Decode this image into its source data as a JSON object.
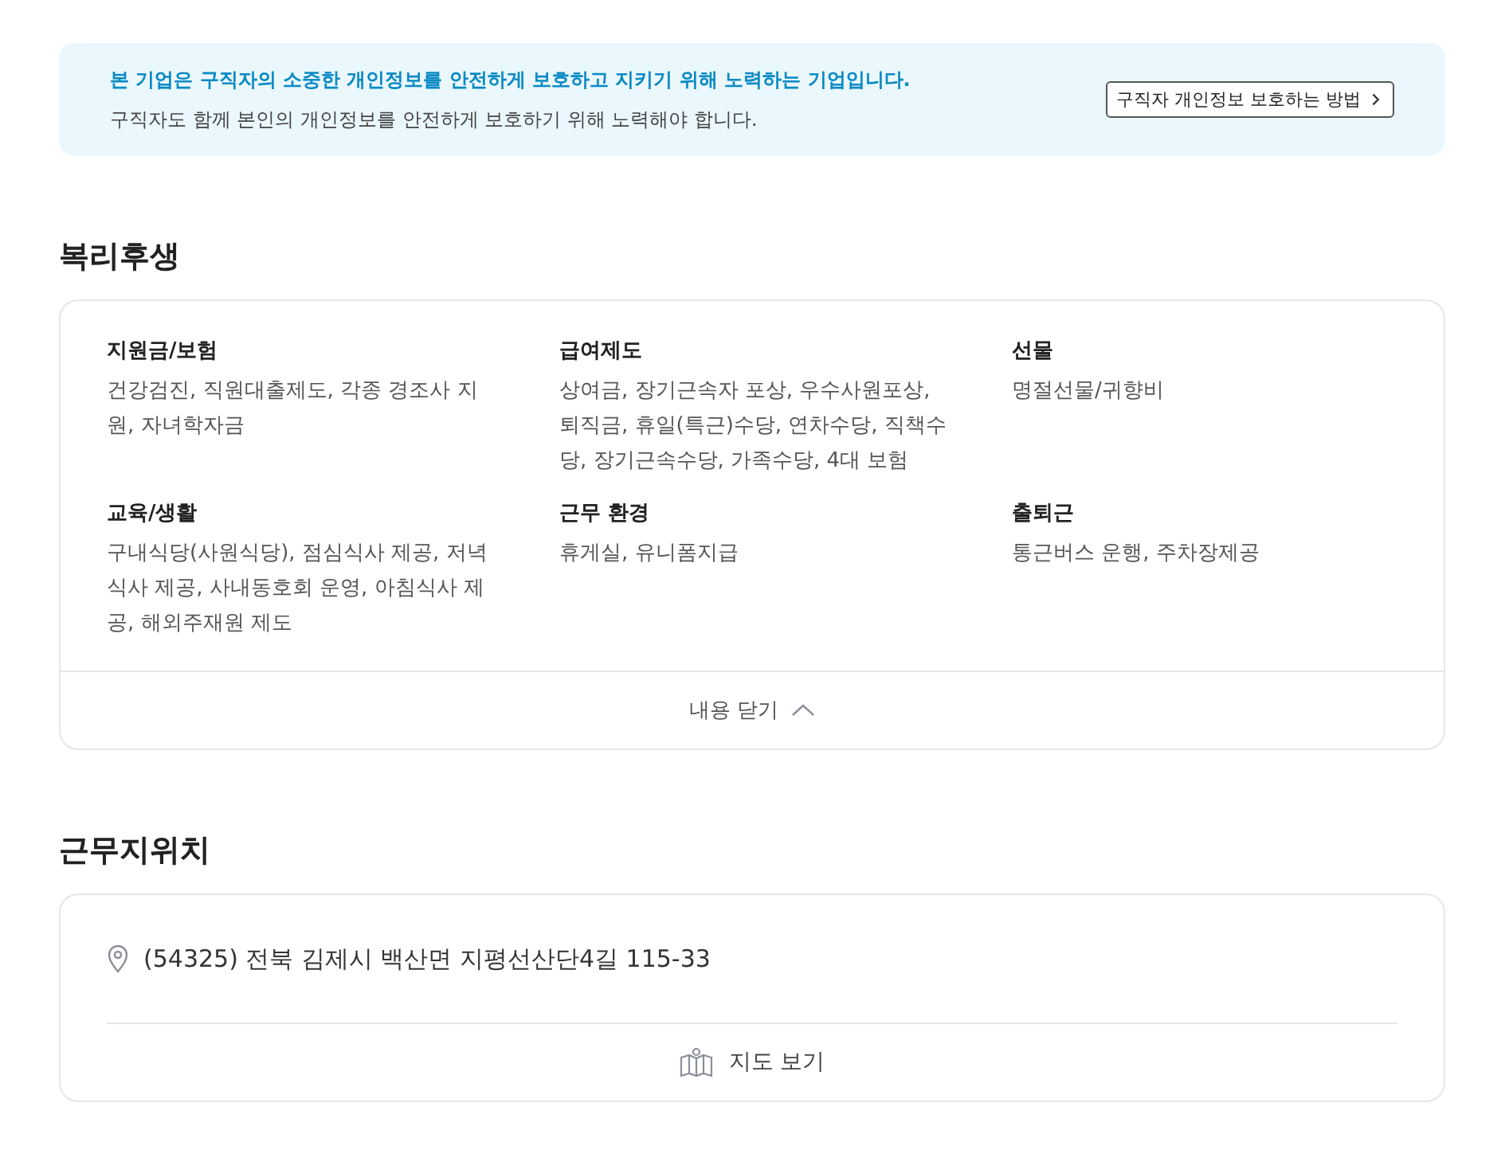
{
  "notice": {
    "headline": "본 기업은 구직자의 소중한 개인정보를 안전하게 보호하고 지키기 위해 노력하는 기업입니다.",
    "body": "구직자도 함께 본인의 개인정보를 안전하게 보호하기 위해 노력해야 합니다.",
    "button": "구직자 개인정보 보호하는 방법"
  },
  "benefits": {
    "title": "복리후생",
    "expanded": true,
    "toggle": "내용 닫기",
    "items": [
      {
        "title": "지원금/보험",
        "text": "건강검진, 직원대출제도, 각종 경조사 지원, 자녀학자금"
      },
      {
        "title": "급여제도",
        "text": "상여금, 장기근속자 포상, 우수사원포상, 퇴직금, 휴일(특근)수당, 연차수당, 직책수당, 장기근속수당, 가족수당, 4대 보험"
      },
      {
        "title": "선물",
        "text": "명절선물/귀향비"
      },
      {
        "title": "교육/생활",
        "text": "구내식당(사원식당), 점심식사 제공, 저녁식사 제공, 사내동호회 운영, 아침식사 제공, 해외주재원 제도"
      },
      {
        "title": "근무 환경",
        "text": "휴게실, 유니폼지급"
      },
      {
        "title": "출퇴근",
        "text": "통근버스 운행, 주차장제공"
      }
    ]
  },
  "location": {
    "title": "근무지위치",
    "address": "(54325) 전북 김제시 백산면 지평선산단4길 115-33",
    "map_button": "지도 보기"
  }
}
